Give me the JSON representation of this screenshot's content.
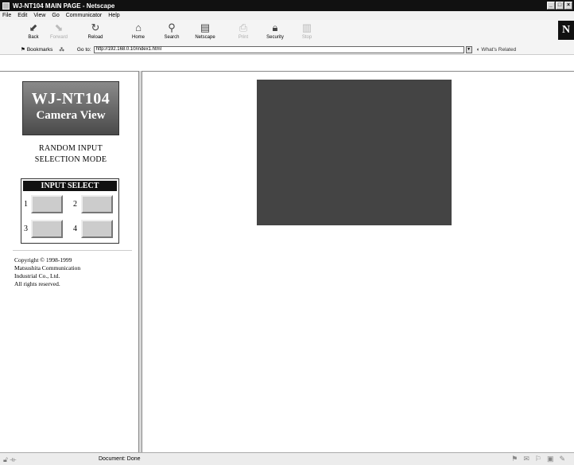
{
  "window": {
    "title": "WJ-NT104 MAIN PAGE - Netscape",
    "controls": [
      "_",
      "□",
      "×"
    ]
  },
  "menu": [
    "File",
    "Edit",
    "View",
    "Go",
    "Communicator",
    "Help"
  ],
  "toolbar": {
    "buttons": [
      {
        "label": "Back",
        "icon": "back-arrow-icon",
        "enabled": true
      },
      {
        "label": "Forward",
        "icon": "forward-arrow-icon",
        "enabled": false
      },
      {
        "label": "Reload",
        "icon": "reload-icon",
        "enabled": true
      },
      {
        "label": "Home",
        "icon": "home-icon",
        "enabled": true
      },
      {
        "label": "Search",
        "icon": "search-icon",
        "enabled": true
      },
      {
        "label": "Netscape",
        "icon": "netscape-icon",
        "enabled": true
      },
      {
        "label": "Print",
        "icon": "print-icon",
        "enabled": false
      },
      {
        "label": "Security",
        "icon": "security-icon",
        "enabled": true
      },
      {
        "label": "Stop",
        "icon": "stop-icon",
        "enabled": false
      }
    ],
    "bookmarks_label": "Bookmarks",
    "goto_label": "Go to:",
    "url": "http://192.168.0.10/index1.html",
    "related_label": "What's Related",
    "logo_letter": "N"
  },
  "left_frame": {
    "logo_title": "WJ-NT104",
    "logo_subtitle": "Camera View",
    "mode_line1": "RANDOM INPUT",
    "mode_line2": "SELECTION MODE",
    "input_select_title": "INPUT SELECT",
    "inputs": [
      "1",
      "2",
      "3",
      "4"
    ],
    "copyright": [
      "Copyright © 1998-1999",
      "Matsushita Communication",
      "Industrial Co., Ltd.",
      "All rights reserved."
    ]
  },
  "status": {
    "text": "Document: Done"
  },
  "colors": {
    "camera_view": "#444444",
    "title_bar": "#111111"
  }
}
